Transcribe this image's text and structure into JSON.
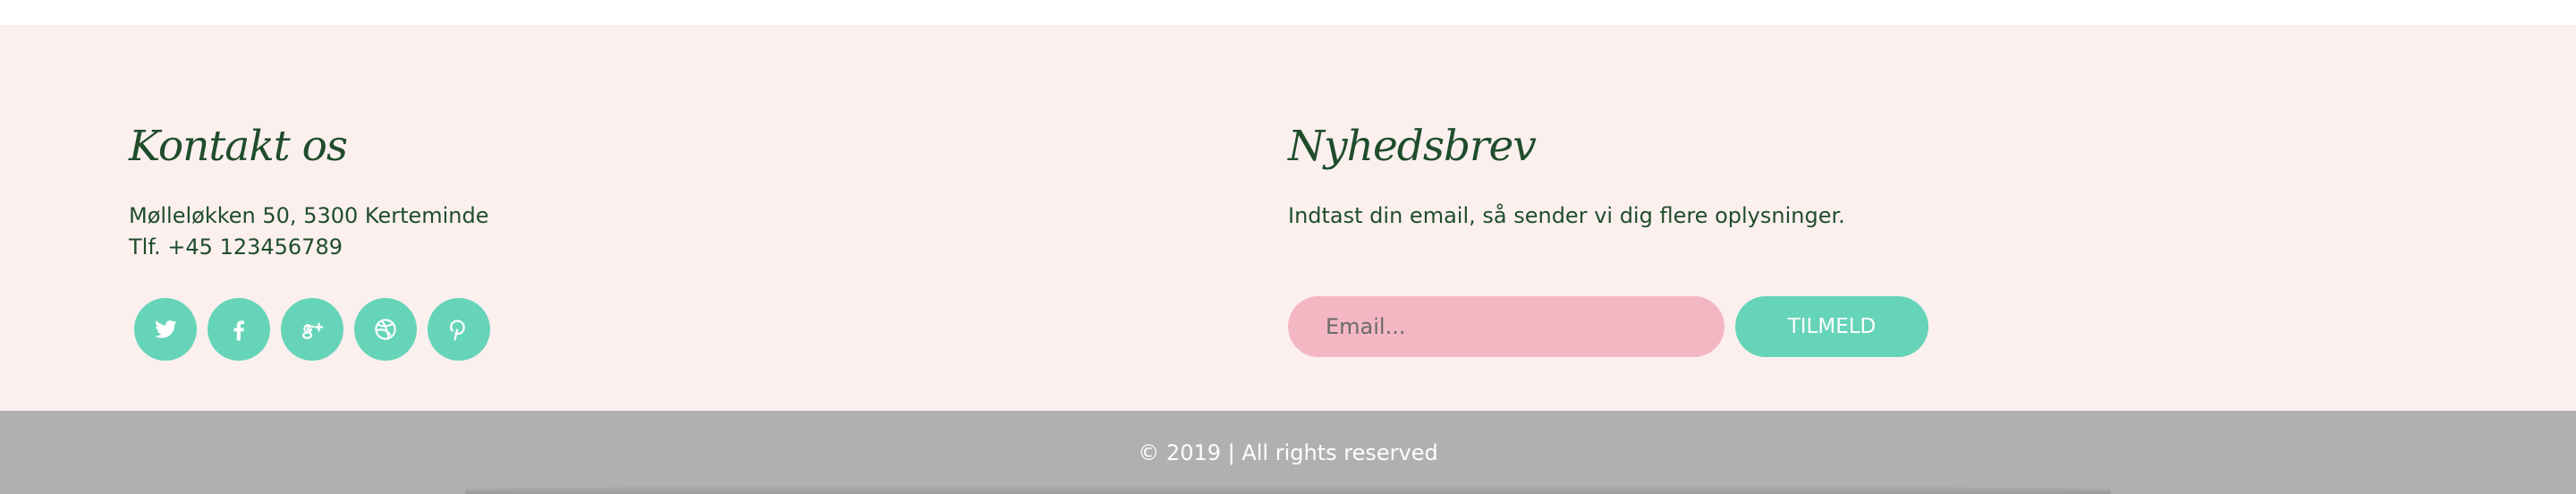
{
  "contact": {
    "heading": "Kontakt os",
    "address": "Mølleløkken 50, 5300 Kerteminde",
    "phone": "Tlf. +45 123456789",
    "social": [
      {
        "name": "twitter-icon"
      },
      {
        "name": "facebook-icon"
      },
      {
        "name": "google-plus-icon"
      },
      {
        "name": "dribbble-icon"
      },
      {
        "name": "pinterest-icon"
      }
    ]
  },
  "newsletter": {
    "heading": "Nyhedsbrev",
    "intro": "Indtast din email, så sender vi dig flere oplysninger.",
    "email_placeholder": "Email...",
    "email_value": "",
    "submit_label": "TILMELD"
  },
  "footer": {
    "copyright": "© 2019 | All rights reserved"
  },
  "colors": {
    "background": "#fcf0ef",
    "heading": "#1f4d2b",
    "accent": "#66d4b8",
    "input": "#f3b7c3",
    "bottom_bar": "#b0b0b0"
  }
}
